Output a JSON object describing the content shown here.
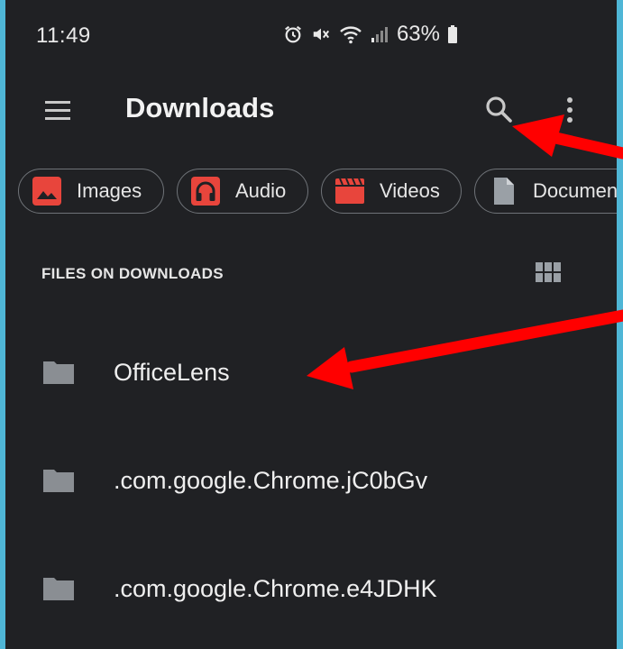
{
  "status_bar": {
    "time": "11:49",
    "battery": "63%",
    "icons": [
      "alarm-icon",
      "mute-icon",
      "wifi-icon",
      "signal-icon",
      "battery-icon"
    ]
  },
  "app_bar": {
    "title": "Downloads",
    "icons": [
      "menu-icon",
      "search-icon",
      "more-vert-icon"
    ]
  },
  "chips": [
    {
      "label": "Images",
      "icon": "image-icon"
    },
    {
      "label": "Audio",
      "icon": "headphones-icon"
    },
    {
      "label": "Videos",
      "icon": "video-icon"
    },
    {
      "label": "Documents",
      "icon": "document-icon"
    }
  ],
  "section": {
    "header": "FILES ON DOWNLOADS",
    "view_toggle_icon": "grid-view-icon"
  },
  "files": [
    {
      "name": "OfficeLens",
      "icon": "folder-icon"
    },
    {
      "name": ".com.google.Chrome.jC0bGv",
      "icon": "folder-icon"
    },
    {
      "name": ".com.google.Chrome.e4JDHK",
      "icon": "folder-icon"
    }
  ],
  "colors": {
    "background": "#202124",
    "accent_red": "#e8453c",
    "icon_gray": "#9aa0a6",
    "annotation_red": "#ff0000",
    "border_frame": "#4fb6d6"
  }
}
